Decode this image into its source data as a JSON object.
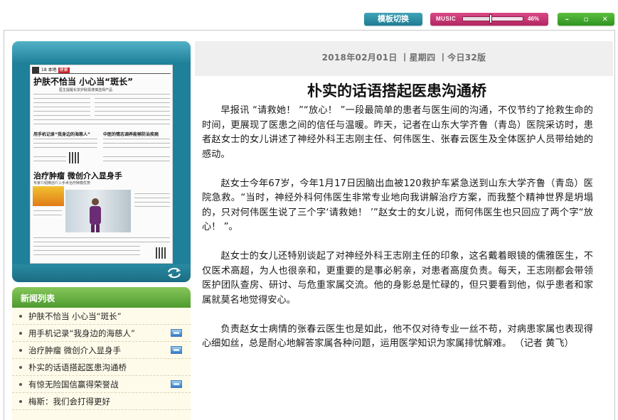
{
  "toolbar": {
    "template_switch_label": "模板切换",
    "music_label": "MUSIC",
    "music_volume_percent": 46,
    "music_volume_text": "46%",
    "minimize_icon": "minimize-icon",
    "restore_icon": "restore-icon",
    "close_icon": "close-icon",
    "minimize_glyph": "–",
    "restore_glyph": "▫",
    "close_glyph": "✕"
  },
  "newspaper": {
    "masthead_page": "18",
    "masthead_section": "本地",
    "masthead_tag": "健康",
    "headline_top": "护肤不恰当  小心当“斑长”",
    "subline_top": "医生提醒化妆护肤需谨慎选择产品",
    "mid_heading_left": "用手机记录“我身边的海慈人”",
    "mid_heading_right": "中医的情志调养能够防治疾病",
    "headline_lower": "治疗肿瘤  微创介入显身手",
    "lower_sub": "专家介绍微创介入手术治疗肿瘤优势"
  },
  "news_list": {
    "heading": "新闻列表",
    "items": [
      {
        "label": "护肤不恰当 小心当“斑长”",
        "has_video": false
      },
      {
        "label": "用手机记录“我身边的海慈人”",
        "has_video": true
      },
      {
        "label": "治疗肿瘤 微创介入显身手",
        "has_video": true
      },
      {
        "label": "朴实的话语搭起医患沟通桥",
        "has_video": false
      },
      {
        "label": "有惊无险国信赢得荣誉战",
        "has_video": true
      },
      {
        "label": "梅斯：我们会打得更好",
        "has_video": false
      }
    ]
  },
  "article": {
    "date_line": "2018年02月01日 丨星期四 丨今日32版",
    "title": "朴实的话语搭起医患沟通桥",
    "paragraphs": [
      "早报讯 “请救她！ ”“放心！ ”一段最简单的患者与医生间的沟通，不仅节约了抢救生命的时间，更展现了医患之间的信任与温暖。昨天，记者在山东大学齐鲁（青岛）医院采访时，患者赵女士的女儿讲述了神经外科王志刚主任、何伟医生、张春云医生及全体医护人员带给她的感动。",
      "赵女士今年67岁，今年1月17日因脑出血被120救护车紧急送到山东大学齐鲁（青岛）医院急救。“当时，神经外科何伟医生非常专业地向我讲解治疗方案，而我整个精神世界是坍塌的，只对何伟医生说了三个字‘请救她！ ’”赵女士的女儿说，而何伟医生也只回应了两个字“放心！ ”。",
      "赵女士的女儿还特别谈起了对神经外科王志刚主任的印象，这名戴着眼镜的儒雅医生，不仅医术高超，为人也很亲和，更重要的是事必躬亲，对患者高度负责。每天，王志刚都会带领医护团队查房、研讨、与危重家属交流。他的身影总是忙碌的，但只要看到他，似乎患者和家属就莫名地觉得安心。",
      "负责赵女士病情的张春云医生也是如此，他不仅对待专业一丝不苟，对病患家属也表现得心细如丝，总是耐心地解答家属各种问题，运用医学知识为家属排忧解难。 （记者 黄飞）"
    ]
  },
  "colors": {
    "teal": "#1f8099",
    "pink": "#b12661",
    "green": "#4e9a2f",
    "list_bg": "#fffbea"
  }
}
